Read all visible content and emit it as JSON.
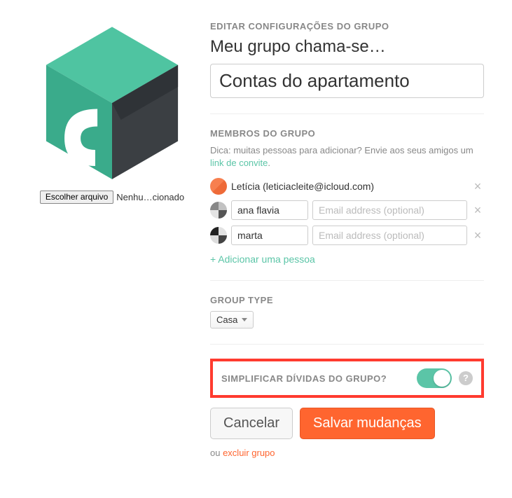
{
  "header": {
    "edit_settings": "EDITAR CONFIGURAÇÕES DO GRUPO",
    "name_label": "Meu grupo chama-se…",
    "group_name": "Contas do apartamento"
  },
  "file": {
    "button": "Escolher arquivo",
    "status": "Nenhu…cionado"
  },
  "members": {
    "heading": "MEMBROS DO GRUPO",
    "hint_prefix": "Dica: muitas pessoas para adicionar? Envie aos seus amigos um ",
    "hint_link": "link de convite",
    "hint_suffix": ".",
    "list": [
      {
        "display": "Letícia (leticiacleite@icloud.com)",
        "name": "",
        "email": "",
        "fixed": true
      },
      {
        "display": "",
        "name": "ana flavia",
        "email": "",
        "fixed": false
      },
      {
        "display": "",
        "name": "marta",
        "email": "",
        "fixed": false
      }
    ],
    "email_placeholder": "Email address (optional)",
    "add_person": "+ Adicionar uma pessoa"
  },
  "group_type": {
    "heading": "GROUP TYPE",
    "selected": "Casa"
  },
  "simplify": {
    "heading": "SIMPLIFICAR DÍVIDAS DO GRUPO?",
    "enabled": true
  },
  "actions": {
    "cancel": "Cancelar",
    "save": "Salvar mudanças",
    "or": "ou ",
    "delete": "excluir grupo"
  }
}
